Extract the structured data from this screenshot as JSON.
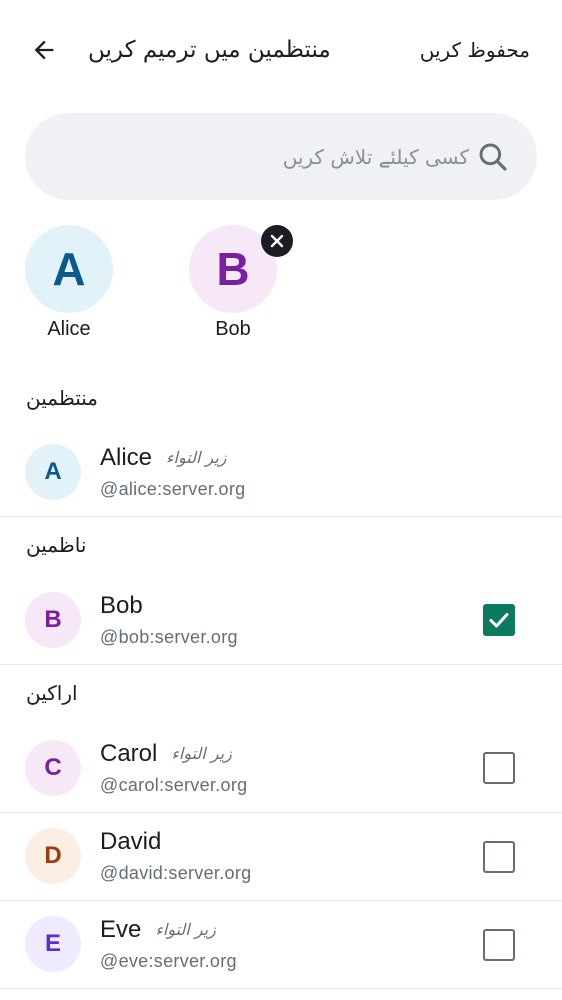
{
  "header": {
    "title": "منتظمین میں ترمیم کریں",
    "save_label": "محفوظ کریں"
  },
  "search": {
    "placeholder": "کسی کیلئے تلاش کریں",
    "value": ""
  },
  "selected_chips": [
    {
      "initial": "A",
      "name": "Alice",
      "removable": false,
      "color": "#0a5a8c",
      "bg": "#e1f3f8"
    },
    {
      "initial": "B",
      "name": "Bob",
      "removable": true,
      "color": "#7b1fa2",
      "bg": "#f7e8f8"
    }
  ],
  "sections": {
    "admins": {
      "label": "منتظمین"
    },
    "moderators": {
      "label": "ناظمین"
    },
    "members": {
      "label": "اراکین"
    }
  },
  "pending_label": "زیر التواء",
  "users": [
    {
      "initial": "A",
      "name": "Alice",
      "id": "@alice:server.org",
      "pending": true,
      "checkbox": "none",
      "color": "#0a5a8c",
      "bg": "#e1f3f8"
    },
    {
      "initial": "B",
      "name": "Bob",
      "id": "@bob:server.org",
      "pending": false,
      "checkbox": "checked",
      "color": "#7b1fa2",
      "bg": "#f7e8f8"
    },
    {
      "initial": "C",
      "name": "Carol",
      "id": "@carol:server.org",
      "pending": true,
      "checkbox": "unchecked",
      "color": "#7b1fa2",
      "bg": "#f7e8f8"
    },
    {
      "initial": "D",
      "name": "David",
      "id": "@david:server.org",
      "pending": false,
      "checkbox": "unchecked",
      "color": "#a13a10",
      "bg": "#fdeee4"
    },
    {
      "initial": "E",
      "name": "Eve",
      "id": "@eve:server.org",
      "pending": true,
      "checkbox": "unchecked",
      "color": "#5b2fc9",
      "bg": "#efeafd"
    }
  ],
  "colors": {
    "accent": "#0b7a5f",
    "search_bg": "#eff1f4",
    "divider": "#e3e6ea"
  }
}
